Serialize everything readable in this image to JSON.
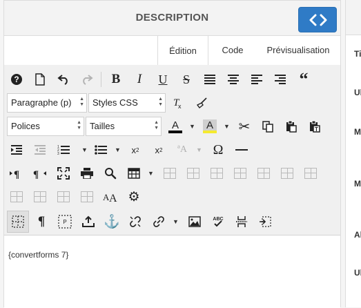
{
  "header": {
    "title": "DESCRIPTION",
    "code_toggle_icon": "code-brackets-icon"
  },
  "tabs": [
    {
      "label": "Édition"
    },
    {
      "label": "Code"
    },
    {
      "label": "Prévisualisation"
    }
  ],
  "toolbar": {
    "paragraph_select": "Paragraphe (p)",
    "css_select": "Styles CSS",
    "fonts_select": "Polices",
    "sizes_select": "Tailles"
  },
  "editor": {
    "content": "{convertforms 7}"
  },
  "right_panel": {
    "labels": [
      "Ti",
      "Ul",
      "M",
      "M",
      "Al",
      "Ul"
    ]
  }
}
